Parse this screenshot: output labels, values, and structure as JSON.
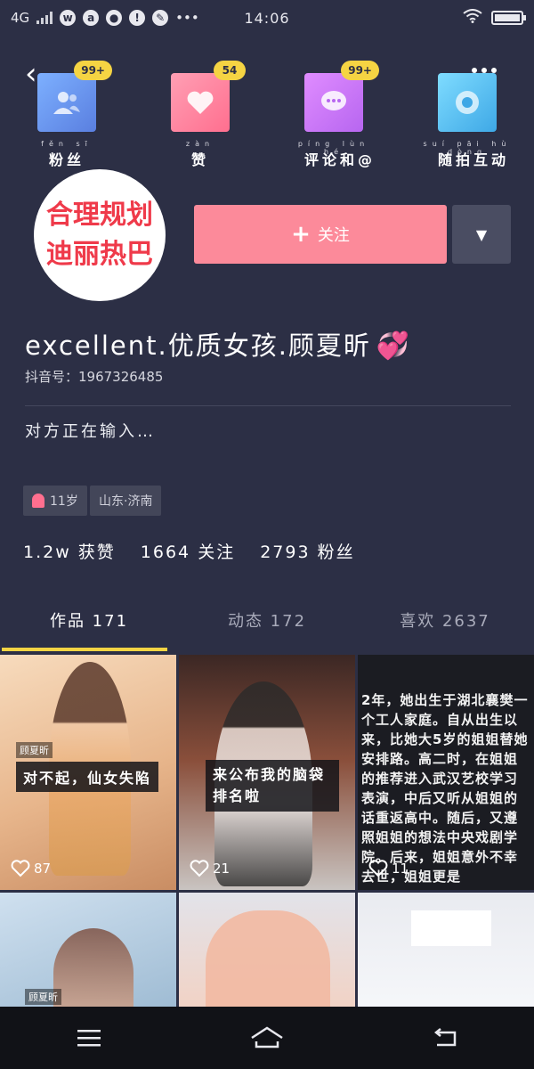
{
  "status_bar": {
    "network": "4G",
    "time": "14:06"
  },
  "notifications": [
    {
      "label": "粉丝",
      "pinyin": "fěn sī",
      "badge": "99+",
      "icon": "fans-icon"
    },
    {
      "label": "赞",
      "pinyin": "zàn",
      "badge": "54",
      "icon": "heart-icon"
    },
    {
      "label": "评论和@",
      "pinyin": "píng lùn hé",
      "badge": "99+",
      "icon": "comment-icon"
    },
    {
      "label": "随拍互动",
      "pinyin": "suí pāi hù dòng",
      "badge": "",
      "icon": "camera-icon"
    }
  ],
  "avatar": {
    "line1": "合理规划",
    "line2": "迪丽热巴"
  },
  "profile": {
    "follow_label": "关注",
    "username": "excellent.优质女孩.顾夏昕",
    "douyin_id": "抖音号：1967326485",
    "typing": "对方正在输入…",
    "tag_age": "11岁",
    "tag_location": "山东·济南",
    "likes_stat": "1.2w 获赞",
    "following_stat": "1664 关注",
    "fans_stat": "2793 粉丝"
  },
  "tabs": [
    {
      "label": "作品 171",
      "active": true
    },
    {
      "label": "动态 172",
      "active": false
    },
    {
      "label": "喜欢 2637",
      "active": false
    }
  ],
  "videos": [
    {
      "name_tag": "顾夏昕",
      "caption": "对不起，仙女失陷",
      "likes": "87"
    },
    {
      "caption": "来公布我的脑袋排名啦",
      "likes": "21"
    },
    {
      "caption": "2年，她出生于湖北襄樊一个工人家庭。自从出生以来，比她大5岁的姐姐替她安排路。高二时，在姐姐的推荐进入武汉艺校学习表演，中后又听从姐姐的话重返高中。随后，又遵照姐姐的想法中央戏剧学院。后来，姐姐意外不幸去世，姐姐更是",
      "likes": "11"
    },
    {
      "name_tag": "顾夏昕",
      "caption": "",
      "likes": ""
    },
    {
      "caption": "",
      "likes": ""
    },
    {
      "caption": "",
      "likes": ""
    }
  ],
  "colors": {
    "background": "#2c2f45",
    "follow_button": "#fc8a9a",
    "badge": "#f5d443",
    "tab_underline": "#f5d443"
  }
}
